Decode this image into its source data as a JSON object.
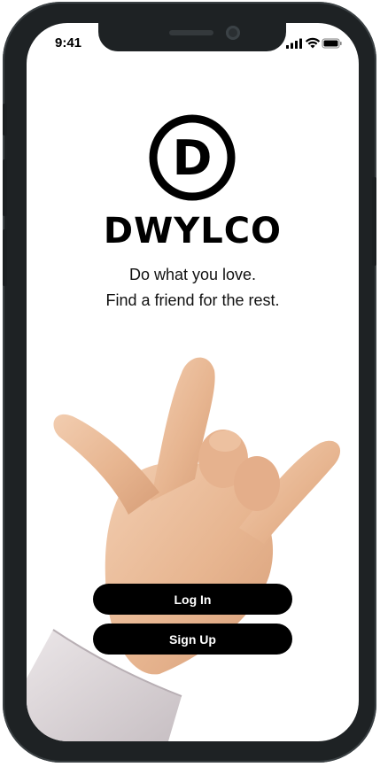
{
  "status_bar": {
    "time": "9:41",
    "icons": [
      "cellular-signal-icon",
      "wifi-icon",
      "battery-icon"
    ]
  },
  "app": {
    "logo_letter": "D",
    "name": "DWYLCO",
    "tagline_line1": "Do what you love.",
    "tagline_line2": "Find a friend for the rest."
  },
  "illustration": {
    "description_icon": "rock-on-hand-icon"
  },
  "actions": {
    "login_label": "Log In",
    "signup_label": "Sign Up"
  },
  "colors": {
    "button_bg": "#000000",
    "button_text": "#ffffff",
    "frame": "#1e2224",
    "skin": "#e9b897"
  }
}
